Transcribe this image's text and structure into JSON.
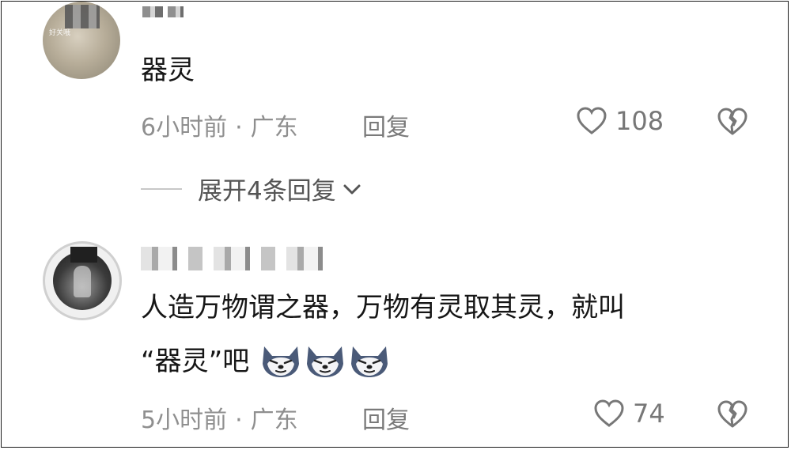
{
  "comments": [
    {
      "text": "器灵",
      "avatar_overlay_text": "好关哦",
      "time": "6小时前",
      "location": "广东",
      "reply_label": "回复",
      "likes": "108",
      "expand_label": "展开4条回复"
    },
    {
      "text_line1": "人造万物谓之器，万物有灵取其灵，就叫",
      "text_line2": "“器灵”吧",
      "emoji_icons": [
        "wolf-emoji-icon",
        "wolf-emoji-icon",
        "wolf-emoji-icon"
      ],
      "time": "5小时前",
      "location": "广东",
      "reply_label": "回复",
      "likes": "74"
    }
  ],
  "separator": "·",
  "colors": {
    "text": "#161616",
    "meta": "#8f8f8f",
    "icon": "#777777"
  }
}
